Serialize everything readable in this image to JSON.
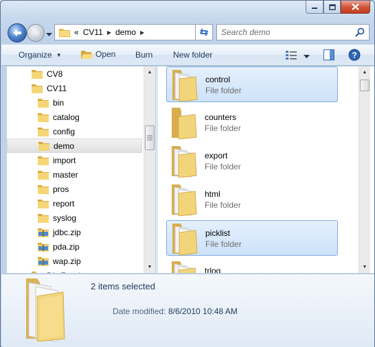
{
  "window": {
    "caption_buttons": [
      "minimize",
      "maximize",
      "close"
    ]
  },
  "address_bar": {
    "overflow": "«",
    "path": [
      "CV11",
      "demo"
    ]
  },
  "search": {
    "placeholder": "Search demo"
  },
  "toolbar": {
    "organize_label": "Organize",
    "open_label": "Open",
    "burn_label": "Burn",
    "new_folder_label": "New folder"
  },
  "navigation_tree": {
    "items": [
      {
        "label": "CV8",
        "type": "folder",
        "indent": 0
      },
      {
        "label": "CV11",
        "type": "folder",
        "indent": 0
      },
      {
        "label": "bin",
        "type": "folder",
        "indent": 1
      },
      {
        "label": "catalog",
        "type": "folder",
        "indent": 1
      },
      {
        "label": "config",
        "type": "folder",
        "indent": 1
      },
      {
        "label": "demo",
        "type": "folder",
        "indent": 1,
        "selected": true
      },
      {
        "label": "import",
        "type": "folder",
        "indent": 1
      },
      {
        "label": "master",
        "type": "folder",
        "indent": 1
      },
      {
        "label": "pros",
        "type": "folder",
        "indent": 1
      },
      {
        "label": "report",
        "type": "folder",
        "indent": 1
      },
      {
        "label": "syslog",
        "type": "folder",
        "indent": 1
      },
      {
        "label": "jdbc.zip",
        "type": "zip",
        "indent": 1
      },
      {
        "label": "pda.zip",
        "type": "zip",
        "indent": 1
      },
      {
        "label": "wap.zip",
        "type": "zip",
        "indent": 1
      },
      {
        "label": "DistReadmes",
        "type": "folder",
        "indent": 0,
        "partial": true
      }
    ]
  },
  "file_list": {
    "items": [
      {
        "name": "control",
        "type": "File folder",
        "selected": true,
        "icon": "folder-with-documents-icon"
      },
      {
        "name": "counters",
        "type": "File folder",
        "selected": false,
        "icon": "folder-icon"
      },
      {
        "name": "export",
        "type": "File folder",
        "selected": false,
        "icon": "folder-with-documents-icon"
      },
      {
        "name": "html",
        "type": "File folder",
        "selected": false,
        "icon": "folder-with-document-icon"
      },
      {
        "name": "picklist",
        "type": "File folder",
        "selected": true,
        "icon": "folder-with-documents-icon"
      },
      {
        "name": "trlog",
        "type": "",
        "selected": false,
        "icon": "folder-with-documents-icon",
        "partial": true
      }
    ]
  },
  "details_pane": {
    "selection_count": "2 items selected",
    "date_label": "Date modified:",
    "date_value": "8/6/2010 10:48 AM"
  },
  "colors": {
    "selection_fill": "#cde2fa",
    "selection_border": "#84acdd",
    "folder_yellow": "#f3d87a",
    "text_dark": "#1e395b"
  }
}
